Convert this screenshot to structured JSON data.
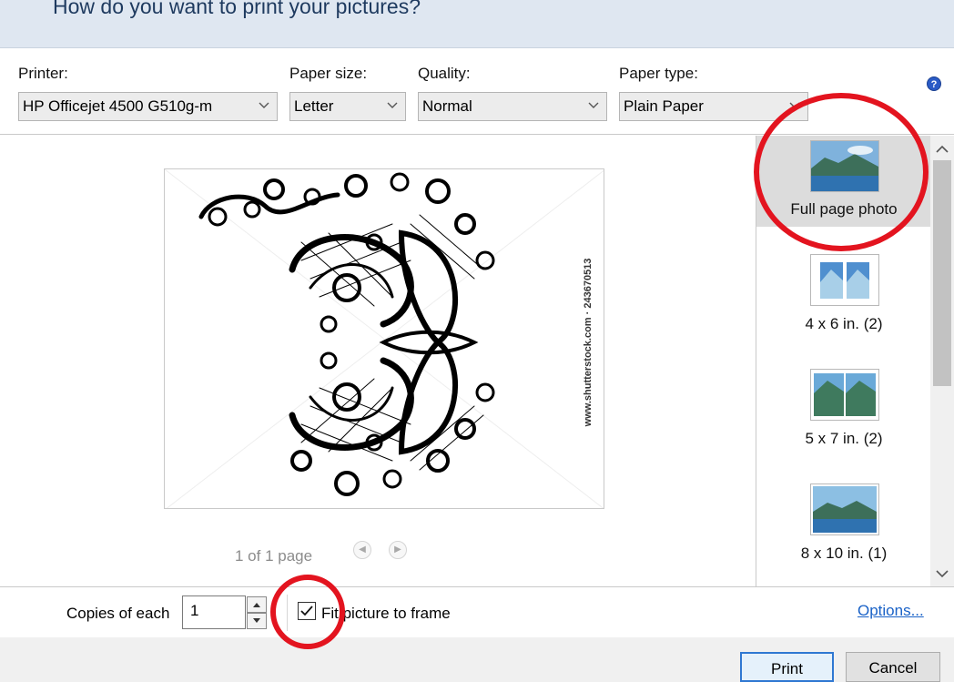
{
  "dialog": {
    "title": "How do you want to print your pictures?"
  },
  "options": {
    "printer_label": "Printer:",
    "printer_value": "HP Officejet 4500 G510g-m",
    "paper_size_label": "Paper size:",
    "paper_size_value": "Letter",
    "quality_label": "Quality:",
    "quality_value": "Normal",
    "paper_type_label": "Paper type:",
    "paper_type_value": "Plain Paper",
    "help_icon": "question-icon",
    "help_glyph": "?"
  },
  "preview": {
    "watermark_text": "www.shutterstock.com · 243670513",
    "page_indicator": "1 of 1 page"
  },
  "layouts": [
    {
      "label": "Full page photo",
      "selected": true
    },
    {
      "label": "4 x 6 in. (2)",
      "selected": false
    },
    {
      "label": "5 x 7 in. (2)",
      "selected": false
    },
    {
      "label": "8 x 10 in. (1)",
      "selected": false
    }
  ],
  "footer": {
    "copies_label": "Copies of each",
    "copies_value": "1",
    "fit_label": "Fit picture to frame",
    "fit_checked": true,
    "options_link": "Options..."
  },
  "buttons": {
    "print": "Print",
    "cancel": "Cancel"
  },
  "colors": {
    "annotation": "#e3141f",
    "link": "#1a62c7",
    "title_bar": "#dfe7f1"
  }
}
